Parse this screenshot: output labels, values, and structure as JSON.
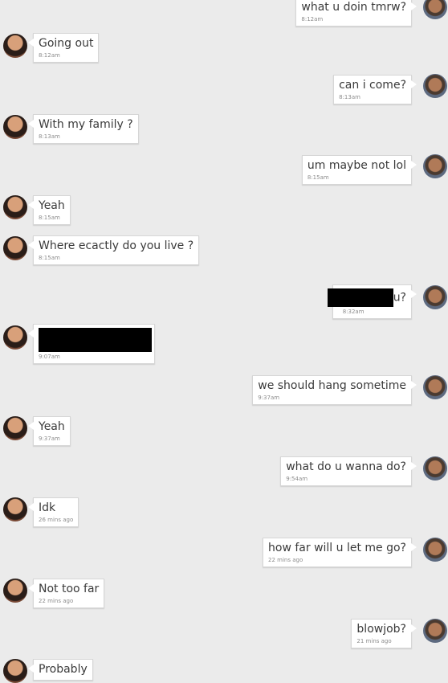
{
  "messages": [
    {
      "side": "right",
      "text": "what u doin tmrw?",
      "time": "8:12am"
    },
    {
      "side": "left",
      "text": "Going out",
      "time": "8:12am"
    },
    {
      "side": "right",
      "text": "can i come?",
      "time": "8:13am"
    },
    {
      "side": "left",
      "text": "With my family ?",
      "time": "8:13am"
    },
    {
      "side": "right",
      "text": "um maybe not lol",
      "time": "8:15am"
    },
    {
      "side": "left",
      "text": "Yeah",
      "time": "8:15am"
    },
    {
      "side": "left",
      "text": "Where ecactly do you live ?",
      "time": "8:15am"
    },
    {
      "side": "right",
      "text": "u?",
      "time": "8:32am",
      "redacted": true
    },
    {
      "side": "left",
      "text": "",
      "time": "9:07am",
      "redacted": true
    },
    {
      "side": "right",
      "text": "we should hang sometime",
      "time": "9:37am"
    },
    {
      "side": "left",
      "text": "Yeah",
      "time": "9:37am"
    },
    {
      "side": "right",
      "text": "what do u wanna do?",
      "time": "9:54am"
    },
    {
      "side": "left",
      "text": "Idk",
      "time": "26 mins ago"
    },
    {
      "side": "right",
      "text": "how far will u let me go?",
      "time": "22 mins ago"
    },
    {
      "side": "left",
      "text": "Not too far",
      "time": "22 mins ago"
    },
    {
      "side": "right",
      "text": "blowjob?",
      "time": "21 mins ago"
    },
    {
      "side": "left",
      "text": "Probably",
      "time": ""
    }
  ]
}
